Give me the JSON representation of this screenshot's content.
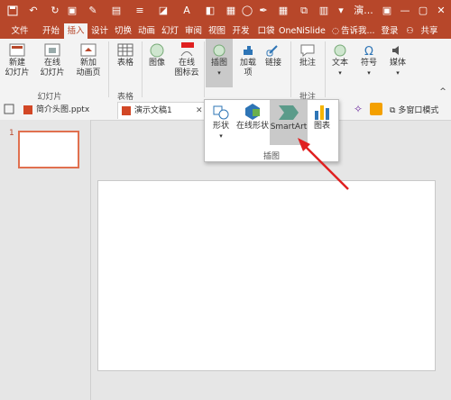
{
  "app": {
    "title": "演...",
    "user": "登录",
    "share": "共享",
    "search": "告诉我..."
  },
  "tabs": [
    "文件",
    "开始",
    "插入",
    "设计",
    "切换",
    "动画",
    "幻灯",
    "审阅",
    "视图",
    "开发",
    "口袋",
    "OneN",
    "iSlide"
  ],
  "ribbon": {
    "groups": {
      "slides": {
        "label": "幻灯片",
        "new_slide": "新建\n幻灯片",
        "online_slide": "在线\n幻灯片",
        "new_anim": "新加\n动画页"
      },
      "tables": {
        "label": "表格",
        "table": "表格"
      },
      "images": {
        "label": "",
        "image": "图像",
        "online_icons": "在线\n图标云"
      },
      "illustrations": {
        "label": "",
        "illustrations": "插图",
        "addins": "加载\n项",
        "links": "链接"
      },
      "comments": {
        "label": "批注",
        "comment": "批注"
      },
      "text": {
        "text": "文本",
        "symbol": "符号",
        "media": "媒体"
      }
    }
  },
  "doc_tabs": {
    "file1": "简介头图.pptx",
    "file2": "演示文稿1",
    "multi_window": "多窗口模式"
  },
  "slide_panel": {
    "number": "1"
  },
  "popup": {
    "label": "插图",
    "shapes": "形状",
    "online_shapes": "在线形状",
    "smartart": "SmartArt",
    "chart": "图表"
  },
  "colors": {
    "accent": "#b7472a",
    "ribbon_bg": "#f3f3f3",
    "arrow": "#e02020"
  }
}
